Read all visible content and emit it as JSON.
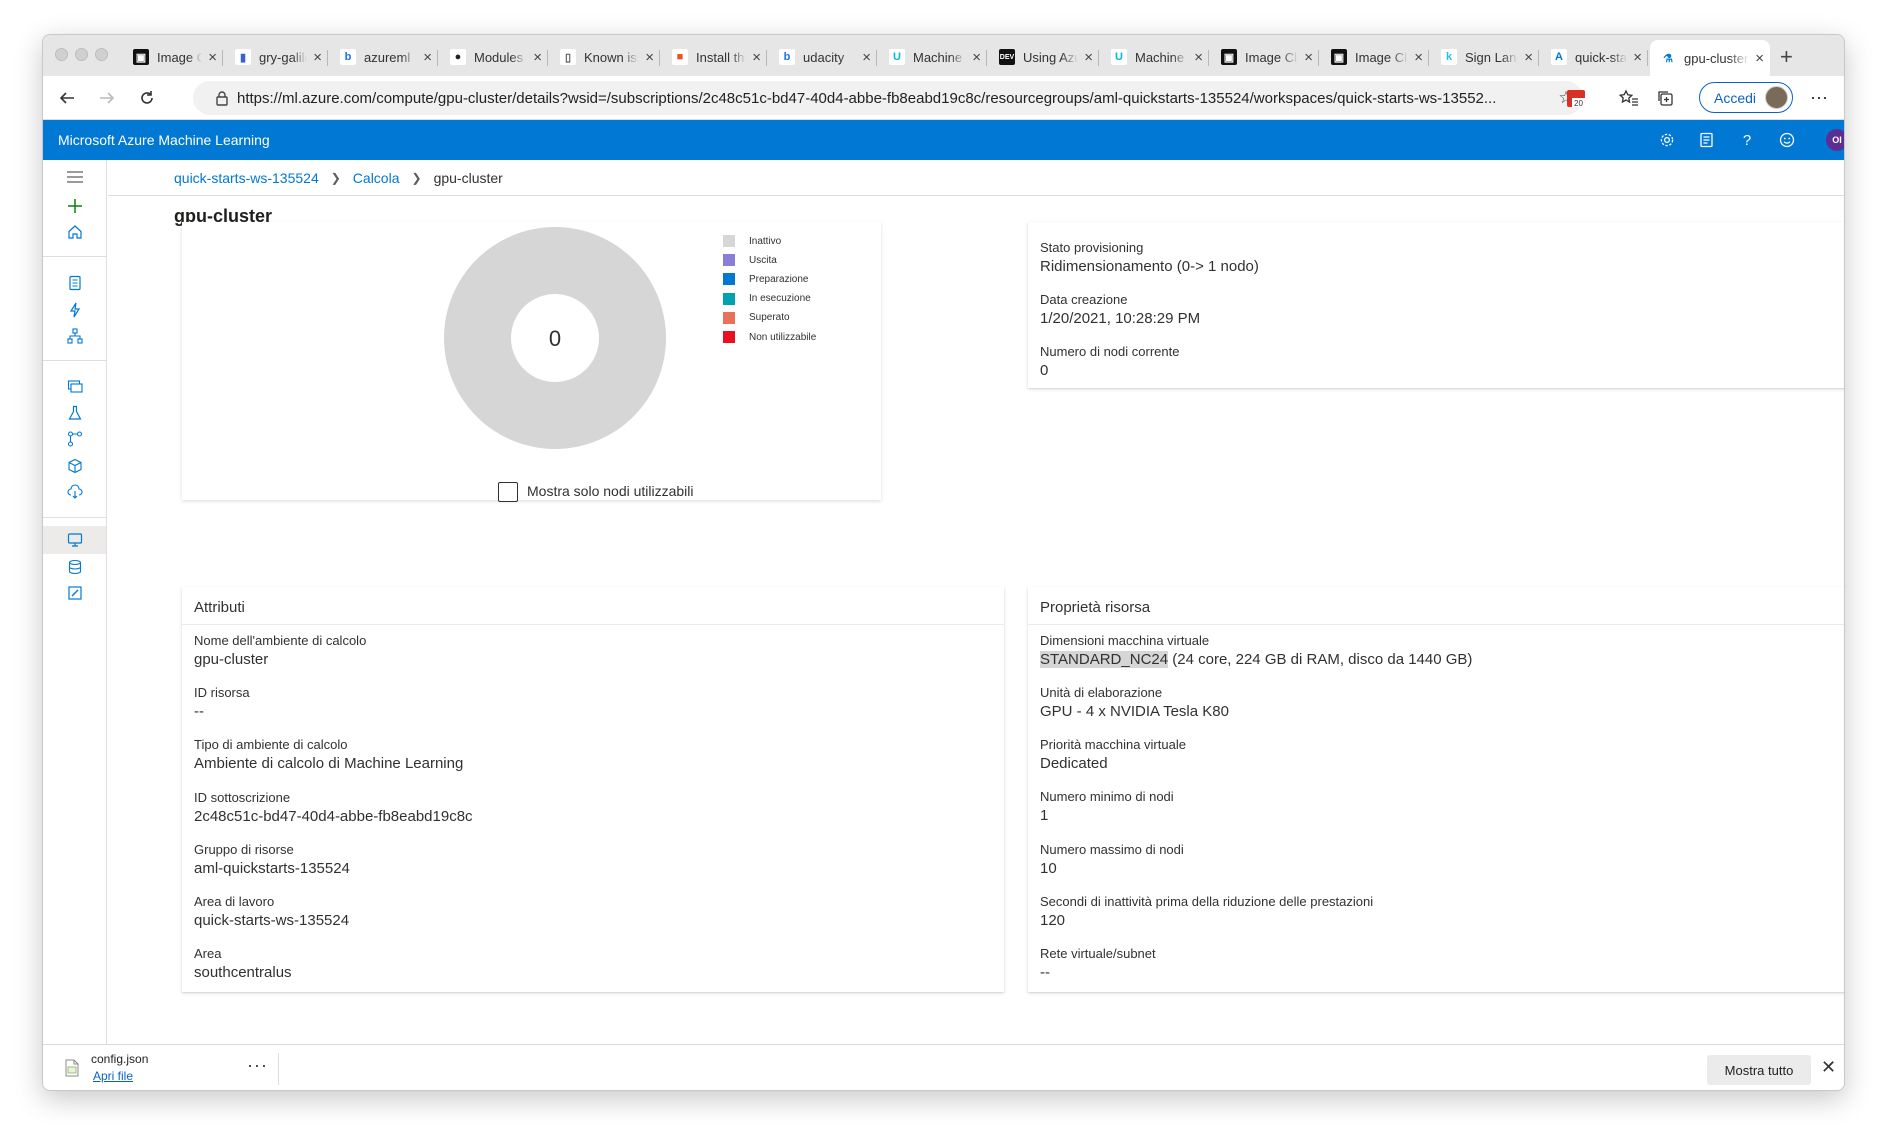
{
  "browser": {
    "tabs": [
      {
        "title": "Image Classification",
        "icon": "tab-icon-video",
        "icon_text": "▣",
        "icon_bg": "#111111",
        "icon_fg": "#ffffff"
      },
      {
        "title": "gry-galileo",
        "icon": "tab-icon-document",
        "icon_text": "▮",
        "icon_bg": "#ffffff",
        "icon_fg": "#3b5fd9"
      },
      {
        "title": "azureml",
        "icon": "tab-icon-bing",
        "icon_text": "b",
        "icon_bg": "#ffffff",
        "icon_fg": "#1a73e8"
      },
      {
        "title": "Modules",
        "icon": "tab-icon-github",
        "icon_text": "●",
        "icon_bg": "#ffffff",
        "icon_fg": "#222222"
      },
      {
        "title": "Known issues",
        "icon": "tab-icon-page",
        "icon_text": "▯",
        "icon_bg": "#ffffff",
        "icon_fg": "#555555"
      },
      {
        "title": "Install the",
        "icon": "tab-icon-microsoft",
        "icon_text": "■",
        "icon_bg": "#ffffff",
        "icon_fg": "#f25022"
      },
      {
        "title": "udacity",
        "icon": "tab-icon-bing",
        "icon_text": "b",
        "icon_bg": "#ffffff",
        "icon_fg": "#1a73e8"
      },
      {
        "title": "Machine",
        "icon": "tab-icon-udacity",
        "icon_text": "U",
        "icon_bg": "#ffffff",
        "icon_fg": "#02b3e4"
      },
      {
        "title": "Using Azure",
        "icon": "tab-icon-dev",
        "icon_text": "DEV",
        "icon_bg": "#111111",
        "icon_fg": "#ffffff"
      },
      {
        "title": "Machine",
        "icon": "tab-icon-udacity",
        "icon_text": "U",
        "icon_bg": "#ffffff",
        "icon_fg": "#02b3e4"
      },
      {
        "title": "Image Classification",
        "icon": "tab-icon-video",
        "icon_text": "▣",
        "icon_bg": "#111111",
        "icon_fg": "#ffffff"
      },
      {
        "title": "Image Classification",
        "icon": "tab-icon-video",
        "icon_text": "▣",
        "icon_bg": "#111111",
        "icon_fg": "#ffffff"
      },
      {
        "title": "Sign Language",
        "icon": "tab-icon-kaggle",
        "icon_text": "k",
        "icon_bg": "#ffffff",
        "icon_fg": "#20beff"
      },
      {
        "title": "quick-starts",
        "icon": "tab-icon-azure",
        "icon_text": "A",
        "icon_bg": "#ffffff",
        "icon_fg": "#0078d4"
      },
      {
        "title": "gpu-cluster",
        "icon": "tab-icon-azureml",
        "icon_text": "⚗",
        "icon_bg": "#ffffff",
        "icon_fg": "#0078d4",
        "active": true
      }
    ],
    "url": "https://ml.azure.com/compute/gpu-cluster/details?wsid=/subscriptions/2c48c51c-bd47-40d4-abbe-fb8eabd19c8c/resourcegroups/aml-quickstarts-135524/workspaces/quick-starts-ws-13552...",
    "signin_label": "Accedi",
    "calendar_badge": "20"
  },
  "app": {
    "title": "Microsoft Azure Machine Learning",
    "user_initials": "OI"
  },
  "breadcrumb": {
    "items": [
      "quick-starts-ws-135524",
      "Calcola"
    ],
    "current": "gpu-cluster"
  },
  "page": {
    "title": "gpu-cluster"
  },
  "node_status": {
    "donut_center": "0",
    "legend": [
      {
        "label": "Inattivo",
        "color": "#d6d6d6"
      },
      {
        "label": "Uscita",
        "color": "#8a7fd6"
      },
      {
        "label": "Preparazione",
        "color": "#0078d4"
      },
      {
        "label": "In esecuzione",
        "color": "#00a2ad"
      },
      {
        "label": "Superato",
        "color": "#e8715a"
      },
      {
        "label": "Non utilizzabile",
        "color": "#e81123"
      }
    ],
    "checkbox_label": "Mostra solo nodi utilizzabili",
    "checkbox_checked": false
  },
  "provisioning": {
    "state_label": "Stato provisioning",
    "state_value": "Ridimensionamento (0-> 1 nodo)",
    "created_label": "Data creazione",
    "created_value": "1/20/2021, 10:28:29 PM",
    "nodes_label": "Numero di nodi corrente",
    "nodes_value": "0"
  },
  "attributes": {
    "heading": "Attributi",
    "items": [
      {
        "label": "Nome dell'ambiente di calcolo",
        "value": "gpu-cluster"
      },
      {
        "label": "ID risorsa",
        "value": "--"
      },
      {
        "label": "Tipo di ambiente di calcolo",
        "value": "Ambiente di calcolo di Machine Learning"
      },
      {
        "label": "ID sottoscrizione",
        "value": "2c48c51c-bd47-40d4-abbe-fb8eabd19c8c"
      },
      {
        "label": "Gruppo di risorse",
        "value": "aml-quickstarts-135524"
      },
      {
        "label": "Area di lavoro",
        "value": "quick-starts-ws-135524"
      },
      {
        "label": "Area",
        "value": "southcentralus"
      }
    ]
  },
  "resource_props": {
    "heading": "Proprietà risorsa",
    "vm_size_label": "Dimensioni macchina virtuale",
    "vm_size_highlight": "STANDARD_NC24",
    "vm_size_detail": " (24 core, 224 GB di RAM, disco da 1440 GB)",
    "items": [
      {
        "label": "Unità di elaborazione",
        "value": "GPU - 4 x NVIDIA Tesla K80"
      },
      {
        "label": "Priorità macchina virtuale",
        "value": "Dedicated"
      },
      {
        "label": "Numero minimo di nodi",
        "value": "1"
      },
      {
        "label": "Numero massimo di nodi",
        "value": "10"
      },
      {
        "label": "Secondi di inattività prima della riduzione delle prestazioni",
        "value": "120"
      },
      {
        "label": "Rete virtuale/subnet",
        "value": "--"
      }
    ]
  },
  "download": {
    "file": "config.json",
    "open_label": "Apri file",
    "show_all_label": "Mostra tutto"
  }
}
